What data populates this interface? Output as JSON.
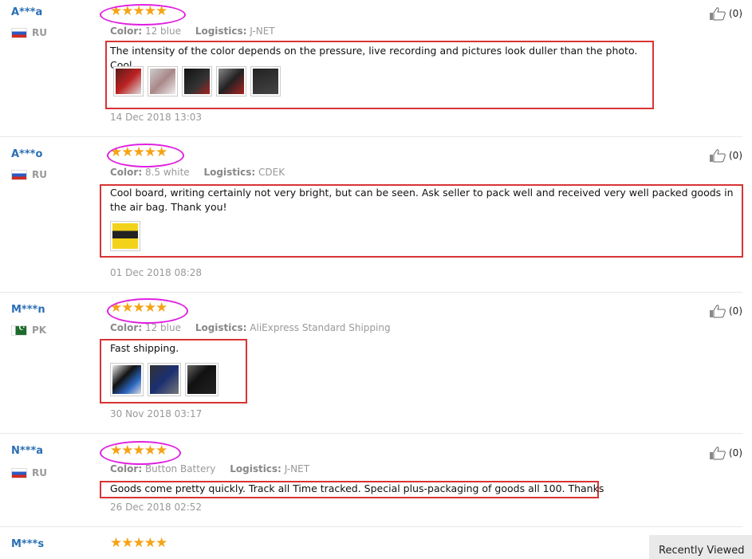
{
  "reviews": [
    {
      "user": "A***a",
      "country": "RU",
      "stars": "★★★★★",
      "color_label": "Color:",
      "color": "12 blue",
      "logistics_label": "Logistics:",
      "logistics": "J-NET",
      "text": "The intensity of the color depends on the pressure, live recording and pictures look duller than the photo. Cool.",
      "date": "14 Dec 2018 13:03",
      "likes": "(0)"
    },
    {
      "user": "A***o",
      "country": "RU",
      "stars": "★★★★★",
      "color_label": "Color:",
      "color": "8.5 white",
      "logistics_label": "Logistics:",
      "logistics": "CDEK",
      "text": "Cool board, writing certainly not very bright, but can be seen. Ask seller to pack well and received very well packed goods in the air bag. Thank you!",
      "date": "01 Dec 2018 08:28",
      "likes": "(0)"
    },
    {
      "user": "M***n",
      "country": "PK",
      "stars": "★★★★★",
      "color_label": "Color:",
      "color": "12 blue",
      "logistics_label": "Logistics:",
      "logistics": "AliExpress Standard Shipping",
      "text": "Fast shipping.",
      "date": "30 Nov 2018 03:17",
      "likes": "(0)"
    },
    {
      "user": "N***a",
      "country": "RU",
      "stars": "★★★★★",
      "color_label": "Color:",
      "color": "Button Battery",
      "logistics_label": "Logistics:",
      "logistics": "J-NET",
      "text": "Goods come pretty quickly. Track all Time tracked. Special plus-packaging of goods all 100. Thanks",
      "date": "26 Dec 2018 02:52",
      "likes": "(0)"
    },
    {
      "user": "M***s",
      "stars": "★★★★★"
    }
  ],
  "recently_viewed": "Recently Viewed",
  "colors": {
    "user": "#2a6fb5",
    "star": "#f5a316",
    "highlight_box": "#d83434",
    "highlight_ellipse": "#e020e0"
  }
}
